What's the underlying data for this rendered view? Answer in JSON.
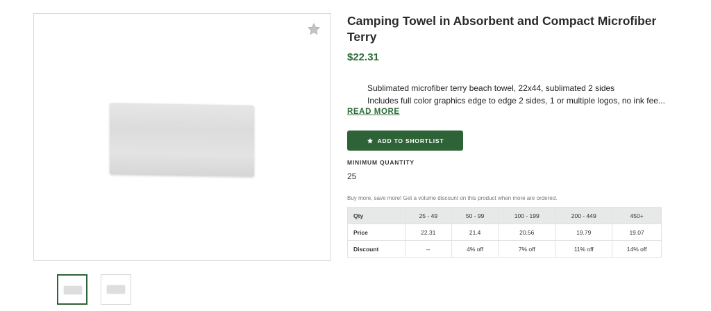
{
  "product": {
    "title": "Camping Towel in Absorbent and Compact Microfiber Terry",
    "price": "$22.31",
    "bullets": [
      "Sublimated microfiber terry beach towel, 22x44, sublimated 2 sides",
      "Includes full color graphics edge to edge 2 sides, 1 or multiple logos, no ink fee..."
    ],
    "read_more": "READ MORE",
    "shortlist_button": "ADD TO SHORTLIST",
    "min_quantity_label": "MINIMUM QUANTITY",
    "min_quantity_value": "25",
    "volume_note": "Buy more, save more! Get a volume discount on this product when more are ordered."
  },
  "pricing_table": {
    "header": [
      "Qty",
      "25 - 49",
      "50 - 99",
      "100 - 199",
      "200 - 449",
      "450+"
    ],
    "rows": [
      [
        "Price",
        "22.31",
        "21.4",
        "20.56",
        "19.79",
        "19.07"
      ],
      [
        "Discount",
        "--",
        "4% off",
        "7% off",
        "11% off",
        "14% off"
      ]
    ]
  },
  "gallery": {
    "thumbnail_count": 2,
    "active_thumbnail": 0
  },
  "icons": {
    "favorite": "star-icon",
    "shortlist": "star-icon"
  },
  "colors": {
    "accent": "#2e6338",
    "price": "#2e6b3a",
    "table_header_bg": "#e6e9e8"
  }
}
